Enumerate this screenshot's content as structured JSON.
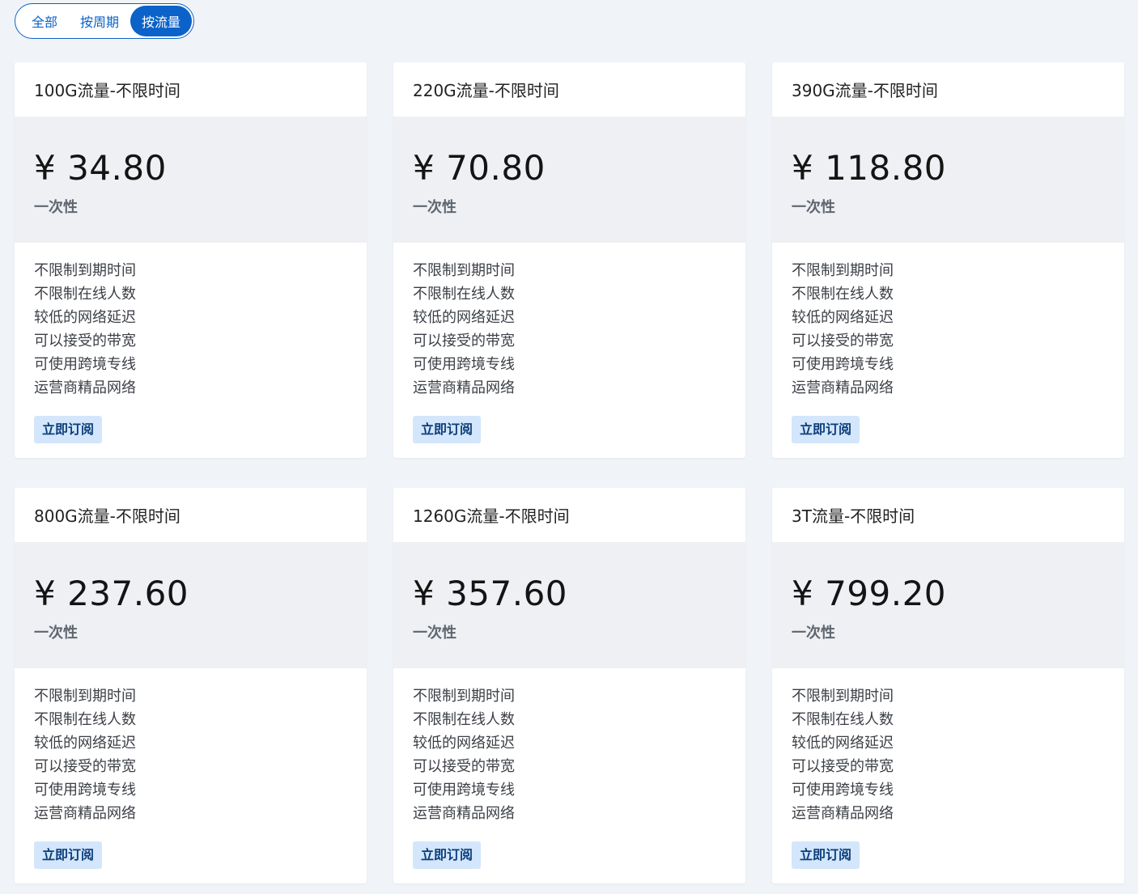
{
  "filters": [
    {
      "label": "全部",
      "active": false
    },
    {
      "label": "按周期",
      "active": false
    },
    {
      "label": "按流量",
      "active": true
    }
  ],
  "plans": [
    {
      "title": "100G流量-不限时间",
      "price": "¥ 34.80",
      "period": "一次性",
      "features": [
        "不限制到期时间",
        "不限制在线人数",
        "较低的网络延迟",
        "可以接受的带宽",
        "可使用跨境专线",
        "运营商精品网络"
      ],
      "button": "立即订阅"
    },
    {
      "title": "220G流量-不限时间",
      "price": "¥ 70.80",
      "period": "一次性",
      "features": [
        "不限制到期时间",
        "不限制在线人数",
        "较低的网络延迟",
        "可以接受的带宽",
        "可使用跨境专线",
        "运营商精品网络"
      ],
      "button": "立即订阅"
    },
    {
      "title": "390G流量-不限时间",
      "price": "¥ 118.80",
      "period": "一次性",
      "features": [
        "不限制到期时间",
        "不限制在线人数",
        "较低的网络延迟",
        "可以接受的带宽",
        "可使用跨境专线",
        "运营商精品网络"
      ],
      "button": "立即订阅"
    },
    {
      "title": "800G流量-不限时间",
      "price": "¥ 237.60",
      "period": "一次性",
      "features": [
        "不限制到期时间",
        "不限制在线人数",
        "较低的网络延迟",
        "可以接受的带宽",
        "可使用跨境专线",
        "运营商精品网络"
      ],
      "button": "立即订阅"
    },
    {
      "title": "1260G流量-不限时间",
      "price": "¥ 357.60",
      "period": "一次性",
      "features": [
        "不限制到期时间",
        "不限制在线人数",
        "较低的网络延迟",
        "可以接受的带宽",
        "可使用跨境专线",
        "运营商精品网络"
      ],
      "button": "立即订阅"
    },
    {
      "title": "3T流量-不限时间",
      "price": "¥ 799.20",
      "period": "一次性",
      "features": [
        "不限制到期时间",
        "不限制在线人数",
        "较低的网络延迟",
        "可以接受的带宽",
        "可使用跨境专线",
        "运营商精品网络"
      ],
      "button": "立即订阅"
    }
  ],
  "colors": {
    "accent": "#0b62c8",
    "button_bg": "#d3e6fb",
    "page_bg": "#f0f3f8",
    "price_bg": "#eef0f3"
  }
}
